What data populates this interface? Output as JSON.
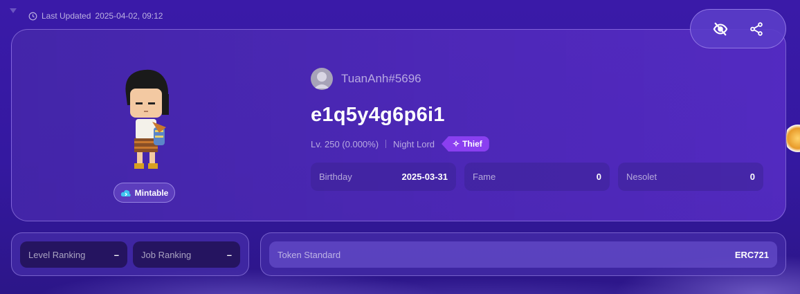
{
  "header": {
    "last_updated_label": "Last Updated",
    "last_updated_value": "2025-04-02, 09:12"
  },
  "actions": {
    "hide_icon": "eye-off-icon",
    "share_icon": "share-icon"
  },
  "character": {
    "mint_status": "Mintable",
    "owner": "TuanAnh#5696",
    "name": "e1q5y4g6p6i1",
    "level": "Lv. 250 (0.000%)",
    "job_name": "Night Lord",
    "job_class": "Thief"
  },
  "stats": [
    {
      "label": "Birthday",
      "value": "2025-03-31"
    },
    {
      "label": "Fame",
      "value": "0"
    },
    {
      "label": "Nesolet",
      "value": "0"
    }
  ],
  "rankings": [
    {
      "label": "Level Ranking",
      "value": "–"
    },
    {
      "label": "Job Ranking",
      "value": "–"
    }
  ],
  "token": {
    "label": "Token Standard",
    "value": "ERC721"
  },
  "colors": {
    "job_badge": "#8a3ff0",
    "mintable_icon": "#3fc6f0"
  }
}
